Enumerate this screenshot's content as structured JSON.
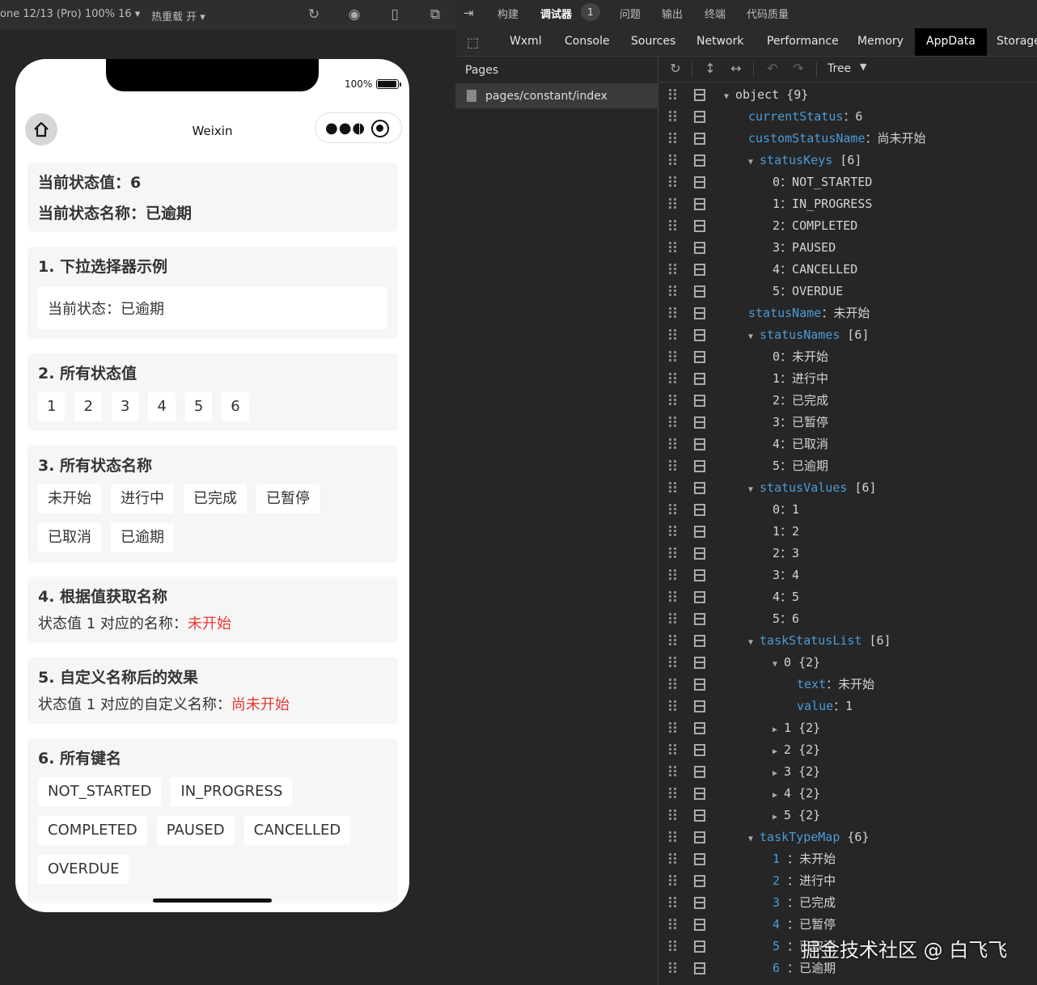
{
  "sim_toolbar": {
    "device": "one 12/13 (Pro) 100% 16 ▾",
    "hot_reload": "热重载 开 ▾"
  },
  "phone": {
    "battery_pct": "100%",
    "nav_title": "Weixin"
  },
  "page": {
    "current_status_label": "当前状态值：6",
    "current_status_name_label": "当前状态名称：已逾期",
    "sec1_title": "1. 下拉选择器示例",
    "sec1_picker": "当前状态：已逾期",
    "sec2_title": "2. 所有状态值",
    "sec2_values": [
      "1",
      "2",
      "3",
      "4",
      "5",
      "6"
    ],
    "sec3_title": "3. 所有状态名称",
    "sec3_names": [
      "未开始",
      "进行中",
      "已完成",
      "已暂停",
      "已取消",
      "已逾期"
    ],
    "sec4_title": "4. 根据值获取名称",
    "sec4_prefix": "状态值 1 对应的名称：",
    "sec4_value": "未开始",
    "sec5_title": "5. 自定义名称后的效果",
    "sec5_prefix": "状态值 1 对应的自定义名称：",
    "sec5_value": "尚未开始",
    "sec6_title": "6. 所有键名",
    "sec6_keys": [
      "NOT_STARTED",
      "IN_PROGRESS",
      "COMPLETED",
      "PAUSED",
      "CANCELLED",
      "OVERDUE"
    ]
  },
  "devtools": {
    "top_items": [
      "构建",
      "调试器",
      "问题",
      "输出",
      "终端",
      "代码质量"
    ],
    "debugger_badge": "1",
    "tabs": [
      "Wxml",
      "Console",
      "Sources",
      "Network",
      "Performance",
      "Memory",
      "AppData",
      "Storage"
    ],
    "active_tab": "AppData",
    "pages_header": "Pages",
    "page_path": "pages/constant/index",
    "view_mode": "Tree"
  },
  "tree_rows": [
    {
      "indent": 0,
      "tri": "down",
      "key": "object",
      "keyclass": "v",
      "sep": " ",
      "val": "{9}"
    },
    {
      "indent": 1,
      "tri": "",
      "key": "currentStatus",
      "keyclass": "k",
      "sep": "：",
      "val": "6"
    },
    {
      "indent": 1,
      "tri": "",
      "key": "customStatusName",
      "keyclass": "k",
      "sep": "：",
      "val": "尚未开始"
    },
    {
      "indent": 1,
      "tri": "down",
      "key": "statusKeys",
      "keyclass": "k",
      "sep": " ",
      "val": "[6]"
    },
    {
      "indent": 2,
      "tri": "",
      "key": "0",
      "keyclass": "idx",
      "sep": "：",
      "val": "NOT_STARTED"
    },
    {
      "indent": 2,
      "tri": "",
      "key": "1",
      "keyclass": "idx",
      "sep": "：",
      "val": "IN_PROGRESS"
    },
    {
      "indent": 2,
      "tri": "",
      "key": "2",
      "keyclass": "idx",
      "sep": "：",
      "val": "COMPLETED"
    },
    {
      "indent": 2,
      "tri": "",
      "key": "3",
      "keyclass": "idx",
      "sep": "：",
      "val": "PAUSED"
    },
    {
      "indent": 2,
      "tri": "",
      "key": "4",
      "keyclass": "idx",
      "sep": "：",
      "val": "CANCELLED"
    },
    {
      "indent": 2,
      "tri": "",
      "key": "5",
      "keyclass": "idx",
      "sep": "：",
      "val": "OVERDUE"
    },
    {
      "indent": 1,
      "tri": "",
      "key": "statusName",
      "keyclass": "k",
      "sep": "：",
      "val": "未开始"
    },
    {
      "indent": 1,
      "tri": "down",
      "key": "statusNames",
      "keyclass": "k",
      "sep": " ",
      "val": "[6]"
    },
    {
      "indent": 2,
      "tri": "",
      "key": "0",
      "keyclass": "idx",
      "sep": "：",
      "val": "未开始"
    },
    {
      "indent": 2,
      "tri": "",
      "key": "1",
      "keyclass": "idx",
      "sep": "：",
      "val": "进行中"
    },
    {
      "indent": 2,
      "tri": "",
      "key": "2",
      "keyclass": "idx",
      "sep": "：",
      "val": "已完成"
    },
    {
      "indent": 2,
      "tri": "",
      "key": "3",
      "keyclass": "idx",
      "sep": "：",
      "val": "已暂停"
    },
    {
      "indent": 2,
      "tri": "",
      "key": "4",
      "keyclass": "idx",
      "sep": "：",
      "val": "已取消"
    },
    {
      "indent": 2,
      "tri": "",
      "key": "5",
      "keyclass": "idx",
      "sep": "：",
      "val": "已逾期"
    },
    {
      "indent": 1,
      "tri": "down",
      "key": "statusValues",
      "keyclass": "k",
      "sep": " ",
      "val": "[6]"
    },
    {
      "indent": 2,
      "tri": "",
      "key": "0",
      "keyclass": "idx",
      "sep": "：",
      "val": "1"
    },
    {
      "indent": 2,
      "tri": "",
      "key": "1",
      "keyclass": "idx",
      "sep": "：",
      "val": "2"
    },
    {
      "indent": 2,
      "tri": "",
      "key": "2",
      "keyclass": "idx",
      "sep": "：",
      "val": "3"
    },
    {
      "indent": 2,
      "tri": "",
      "key": "3",
      "keyclass": "idx",
      "sep": "：",
      "val": "4"
    },
    {
      "indent": 2,
      "tri": "",
      "key": "4",
      "keyclass": "idx",
      "sep": "：",
      "val": "5"
    },
    {
      "indent": 2,
      "tri": "",
      "key": "5",
      "keyclass": "idx",
      "sep": "：",
      "val": "6"
    },
    {
      "indent": 1,
      "tri": "down",
      "key": "taskStatusList",
      "keyclass": "k",
      "sep": " ",
      "val": "[6]"
    },
    {
      "indent": 2,
      "tri": "down",
      "key": "0",
      "keyclass": "idx",
      "sep": " ",
      "val": "{2}"
    },
    {
      "indent": 3,
      "tri": "",
      "key": "text",
      "keyclass": "k",
      "sep": "：",
      "val": "未开始"
    },
    {
      "indent": 3,
      "tri": "",
      "key": "value",
      "keyclass": "k",
      "sep": "：",
      "val": "1"
    },
    {
      "indent": 2,
      "tri": "right",
      "key": "1",
      "keyclass": "idx",
      "sep": " ",
      "val": "{2}"
    },
    {
      "indent": 2,
      "tri": "right",
      "key": "2",
      "keyclass": "idx",
      "sep": " ",
      "val": "{2}"
    },
    {
      "indent": 2,
      "tri": "right",
      "key": "3",
      "keyclass": "idx",
      "sep": " ",
      "val": "{2}"
    },
    {
      "indent": 2,
      "tri": "right",
      "key": "4",
      "keyclass": "idx",
      "sep": " ",
      "val": "{2}"
    },
    {
      "indent": 2,
      "tri": "right",
      "key": "5",
      "keyclass": "idx",
      "sep": " ",
      "val": "{2}"
    },
    {
      "indent": 1,
      "tri": "down",
      "key": "taskTypeMap",
      "keyclass": "k",
      "sep": " ",
      "val": "{6}"
    },
    {
      "indent": 2,
      "tri": "",
      "key": "1",
      "keyclass": "k",
      "sep": " ：",
      "val": "未开始"
    },
    {
      "indent": 2,
      "tri": "",
      "key": "2",
      "keyclass": "k",
      "sep": " ：",
      "val": "进行中"
    },
    {
      "indent": 2,
      "tri": "",
      "key": "3",
      "keyclass": "k",
      "sep": " ：",
      "val": "已完成"
    },
    {
      "indent": 2,
      "tri": "",
      "key": "4",
      "keyclass": "k",
      "sep": " ：",
      "val": "已暂停"
    },
    {
      "indent": 2,
      "tri": "",
      "key": "5",
      "keyclass": "k",
      "sep": " ：",
      "val": "已取消"
    },
    {
      "indent": 2,
      "tri": "",
      "key": "6",
      "keyclass": "k",
      "sep": " ：",
      "val": "已逾期"
    }
  ],
  "watermark": "掘金技术社区 @ 白飞飞",
  "colors": {
    "accent_red": "#e53935",
    "tree_key": "#4a9bd8"
  }
}
